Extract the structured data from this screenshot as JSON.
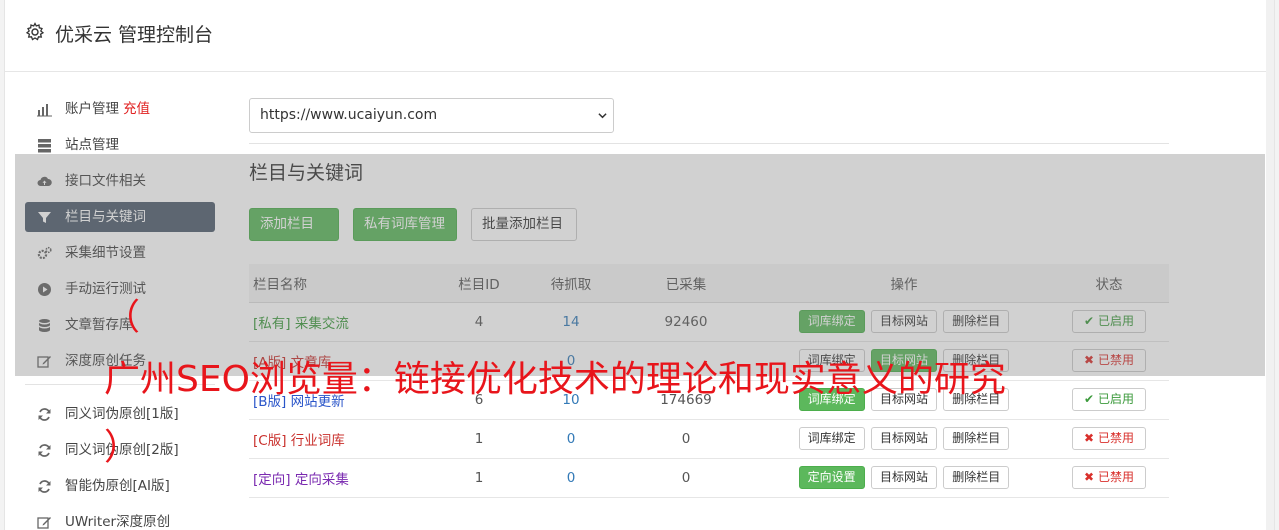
{
  "header": {
    "title": "优采云 管理控制台",
    "icon": "gear-icon"
  },
  "sidebar": {
    "items": [
      {
        "label": "账户管理",
        "extra": "充值",
        "icon": "bar-chart-icon"
      },
      {
        "label": "站点管理",
        "icon": "server-icon"
      },
      {
        "label": "接口文件相关",
        "icon": "cloud-upload-icon"
      },
      {
        "label": "栏目与关键词",
        "icon": "filter-icon",
        "active": true
      },
      {
        "label": "采集细节设置",
        "icon": "cogs-icon"
      },
      {
        "label": "手动运行测试",
        "icon": "play-circle-icon"
      },
      {
        "label": "文章暂存库",
        "icon": "database-icon"
      },
      {
        "label": "深度原创任务",
        "icon": "edit-icon"
      }
    ],
    "items2": [
      {
        "label": "同义词伪原创[1版]",
        "icon": "refresh-icon"
      },
      {
        "label": "同义词伪原创[2版]",
        "icon": "refresh-icon"
      },
      {
        "label": "智能伪原创[AI版]",
        "icon": "refresh-icon"
      },
      {
        "label": "UWriter深度原创",
        "icon": "edit-icon"
      }
    ]
  },
  "main": {
    "site_select_value": "https://www.ucaiyun.com",
    "section_title": "栏目与关键词",
    "buttons": {
      "add": "添加栏目 +",
      "private": "私有词库管理",
      "batch": "批量添加栏目"
    },
    "table": {
      "headers": [
        "栏目名称",
        "栏目ID",
        "待抓取",
        "已采集",
        "操作",
        "状态"
      ],
      "rows": [
        {
          "tag": "[私有]",
          "name": "采集交流",
          "id": "4",
          "pending": "14",
          "collected": "92460",
          "op1": "词库绑定",
          "op2": "目标网站",
          "op3": "删除栏目",
          "state": "已启用"
        },
        {
          "tag": "[A版]",
          "name": "文章库",
          "id": "",
          "pending": "0",
          "collected": "",
          "op1": "词库绑定",
          "op2": "目标网站",
          "op3": "删除栏目",
          "state": "已禁用"
        },
        {
          "tag": "[B版]",
          "name": "网站更新",
          "id": "6",
          "pending": "10",
          "collected": "174669",
          "op1": "词库绑定",
          "op2": "目标网站",
          "op3": "删除栏目",
          "state": "已启用"
        },
        {
          "tag": "[C版]",
          "name": "行业词库",
          "id": "1",
          "pending": "0",
          "collected": "0",
          "op1": "词库绑定",
          "op2": "目标网站",
          "op3": "删除栏目",
          "state": "已禁用"
        },
        {
          "tag": "[定向]",
          "name": "定向采集",
          "id": "1",
          "pending": "0",
          "collected": "0",
          "op1": "定向设置",
          "op2": "目标网站",
          "op3": "删除栏目",
          "state": "已禁用"
        }
      ]
    }
  },
  "overlay_text": {
    "open_paren": "（",
    "headline": "广州SEO浏览量：链接优化技术的理论和现实意义的研究",
    "close_paren": "）"
  },
  "colors": {
    "active_nav": "#4f5d6e",
    "green": "#5cb85c",
    "headline_red": "#e8151b"
  }
}
